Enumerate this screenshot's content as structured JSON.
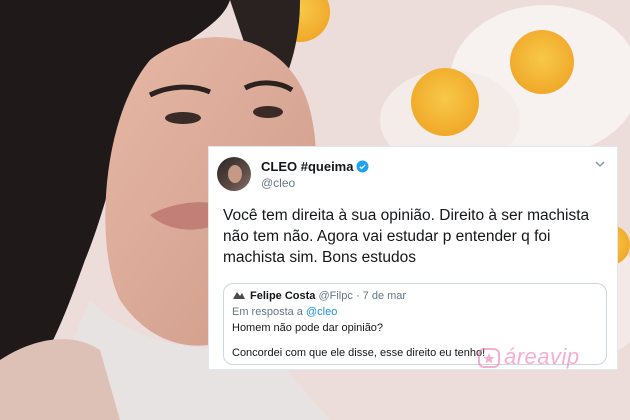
{
  "tweet": {
    "display_name": "CLEO #queima",
    "handle": "@cleo",
    "text": "Você tem direita à sua opinião. Direito à ser machista não tem não. Agora vai estudar p entender q foi machista sim. Bons estudos",
    "verified": true
  },
  "quoted": {
    "display_name": "Felipe Costa",
    "handle": "@Filpc",
    "separator": "·",
    "date": "7 de mar",
    "reply_prefix": "Em resposta a",
    "reply_to": "@cleo",
    "line1": "Homem não pode dar opinião?",
    "line2": "Concordei com  que ele disse, esse direito eu tenho!"
  },
  "watermark": {
    "text": "áreavip",
    "color": "#eb78b4"
  },
  "icons": [
    "verified-badge-icon",
    "chevron-down-icon",
    "star-icon"
  ]
}
